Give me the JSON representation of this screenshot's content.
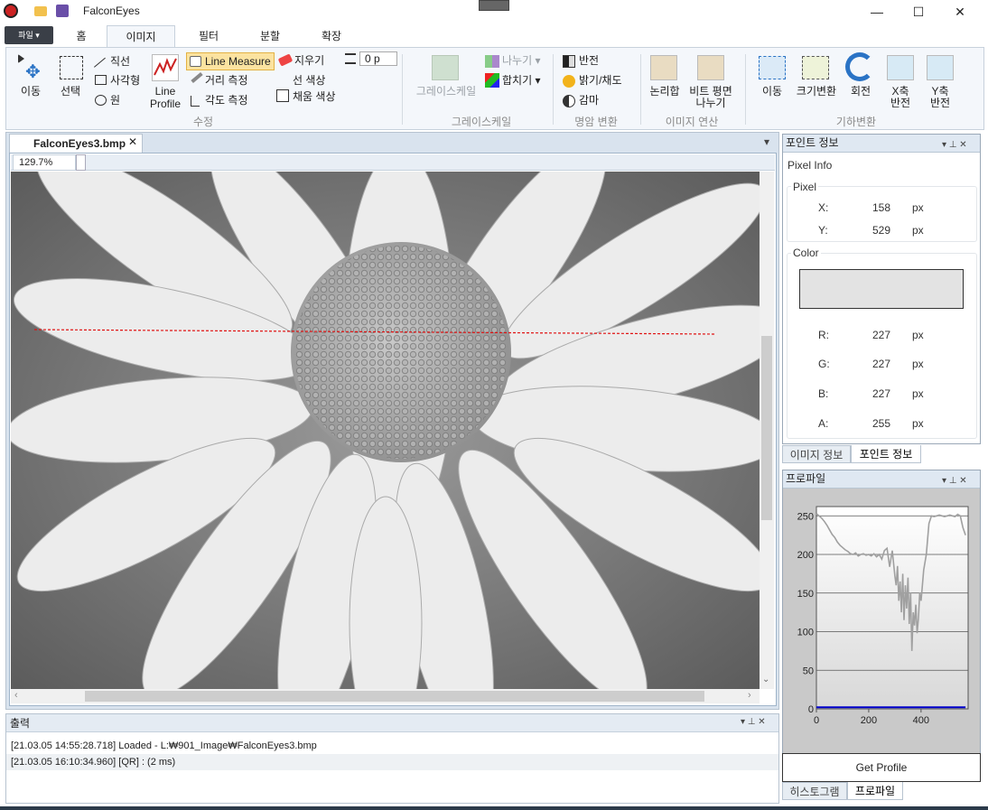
{
  "window": {
    "title": "FalconEyes",
    "minimize": "—",
    "maximize": "☐",
    "close": "✕"
  },
  "ribbon": {
    "file_label": "파일 ▾",
    "tabs": [
      "홈",
      "이미지",
      "필터",
      "분할",
      "확장"
    ],
    "edit": {
      "move": "이동",
      "select": "선택",
      "line": "직선",
      "rect": "사각형",
      "circle": "원",
      "line_profile_1": "Line",
      "line_profile_2": "Profile",
      "line_measure": "Line Measure",
      "distance": "거리 측정",
      "angle": "각도 측정",
      "eraser": "지우기",
      "width_value": "0 p",
      "line_color": "선 색상",
      "fill_color": "채움 색상",
      "group": "수정"
    },
    "grayscale": {
      "grayscale": "그레이스케일",
      "split": "나누기 ▾",
      "merge": "합치기 ▾",
      "group": "그레이스케일"
    },
    "contrast": {
      "invert": "반전",
      "brightness": "밝기/채도",
      "gamma": "감마",
      "group": "명암 변환"
    },
    "image_ops": {
      "logic": "논리합",
      "bitplane_1": "비트 평면",
      "bitplane_2": "나누기",
      "group": "이미지 연산"
    },
    "geometry": {
      "move": "이동",
      "resize": "크기변환",
      "rotate": "회전",
      "xflip_1": "X축",
      "xflip_2": "반전",
      "yflip_1": "Y축",
      "yflip_2": "반전",
      "group": "기하변환"
    }
  },
  "document": {
    "tab": "FalconEyes3.bmp",
    "close": "✕",
    "zoom": "129.7%",
    "menu": "▾"
  },
  "output": {
    "title": "출력",
    "lines": [
      "[21.03.05 14:55:28.718] Loaded  - L:₩901_Image₩FalconEyes3.bmp",
      "[21.03.05 16:10:34.960] [QR]  :  (2 ms)"
    ]
  },
  "point_info": {
    "title": "포인트 정보",
    "heading": "Pixel Info",
    "pixel_group": "Pixel",
    "x_label": "X:",
    "x_value": "158",
    "x_unit": "px",
    "y_label": "Y:",
    "y_value": "529",
    "y_unit": "px",
    "color_group": "Color",
    "swatch_color": "#e3e3e3",
    "r_label": "R:",
    "r_value": "227",
    "r_unit": "px",
    "g_label": "G:",
    "g_value": "227",
    "g_unit": "px",
    "b_label": "B:",
    "b_value": "227",
    "b_unit": "px",
    "a_label": "A:",
    "a_value": "255",
    "a_unit": "px",
    "tabs": [
      "이미지 정보",
      "포인트 정보"
    ]
  },
  "profile": {
    "title": "프로파일",
    "button": "Get Profile",
    "tabs": [
      "히스토그램",
      "프로파일"
    ]
  },
  "chart_data": {
    "type": "line",
    "title": "",
    "xlabel": "",
    "ylabel": "",
    "xlim": [
      0,
      580
    ],
    "ylim": [
      0,
      255
    ],
    "xticks": [
      0,
      200,
      400
    ],
    "yticks": [
      0,
      50,
      100,
      150,
      200,
      250
    ],
    "series": [
      {
        "color": "#a0a0a0",
        "x": [
          0,
          10,
          20,
          30,
          40,
          50,
          60,
          70,
          80,
          90,
          100,
          110,
          120,
          130,
          140,
          150,
          160,
          170,
          180,
          190,
          200,
          210,
          220,
          230,
          240,
          250,
          260,
          270,
          280,
          290,
          300,
          305,
          310,
          315,
          320,
          325,
          330,
          335,
          340,
          345,
          350,
          355,
          360,
          365,
          370,
          375,
          380,
          385,
          390,
          395,
          400,
          410,
          420,
          430,
          440,
          450,
          460,
          470,
          480,
          490,
          500,
          510,
          520,
          530,
          540,
          550,
          560,
          570
        ],
        "y": [
          253,
          250,
          247,
          243,
          238,
          232,
          226,
          222,
          216,
          212,
          209,
          206,
          204,
          201,
          200,
          202,
          198,
          200,
          201,
          199,
          200,
          198,
          201,
          197,
          200,
          194,
          205,
          208,
          184,
          205,
          172,
          160,
          185,
          140,
          165,
          125,
          175,
          115,
          160,
          130,
          170,
          110,
          150,
          75,
          125,
          108,
          135,
          98,
          118,
          150,
          140,
          180,
          200,
          240,
          250,
          249,
          250,
          251,
          250,
          249,
          250,
          251,
          250,
          249,
          252,
          250,
          235,
          225
        ]
      },
      {
        "color": "#0000cc",
        "x": [
          0,
          570
        ],
        "y": [
          2,
          2
        ]
      }
    ]
  }
}
